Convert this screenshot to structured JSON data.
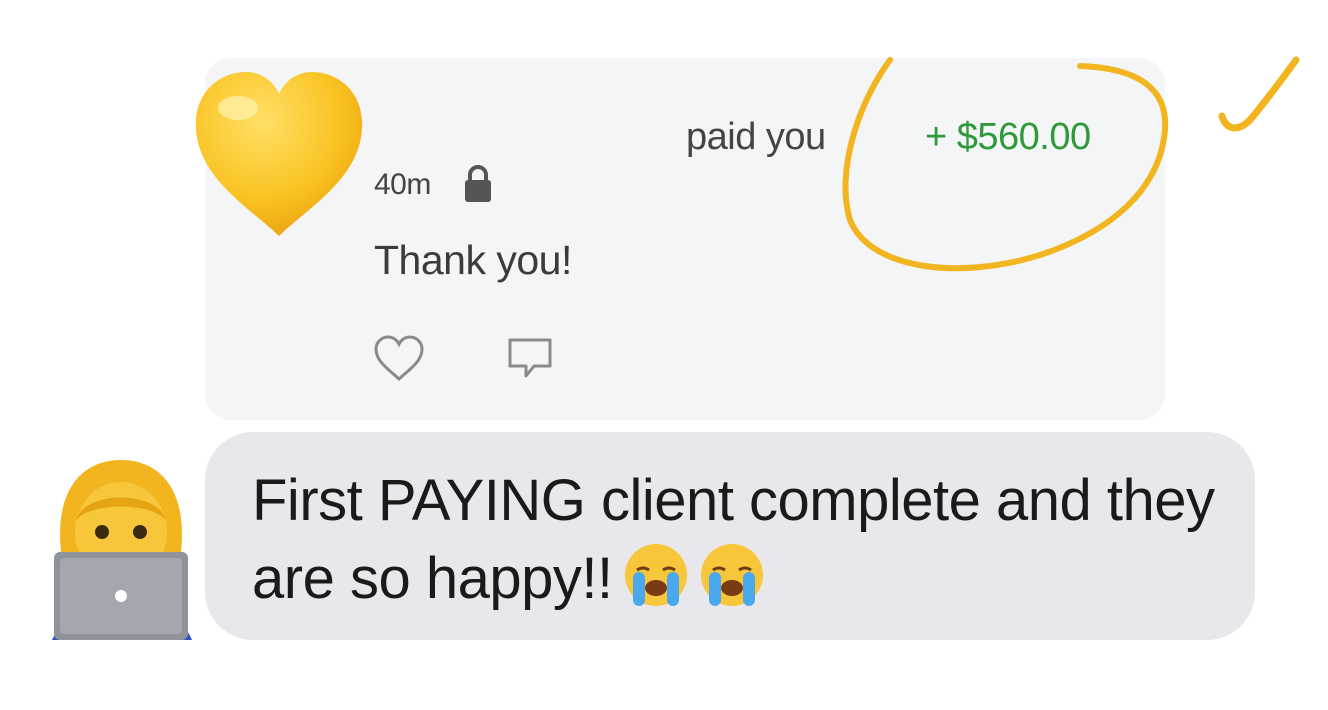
{
  "payment": {
    "time_ago": "40m",
    "note": "Thank you!",
    "action": "paid you",
    "amount": "+ $560.00",
    "amount_color": "#2f9a3a",
    "icons": [
      "yellow-heart-emoji",
      "lock-icon",
      "like-heart-icon",
      "comment-icon"
    ]
  },
  "message": {
    "text": "First PAYING client complete and they are so happy!!",
    "emojis": [
      "loudly-crying-face",
      "loudly-crying-face"
    ],
    "avatar": "woman-technologist-emoji"
  },
  "annotation": {
    "color": "#f2b51f",
    "shape": "hand-drawn circle around amount with check mark"
  }
}
